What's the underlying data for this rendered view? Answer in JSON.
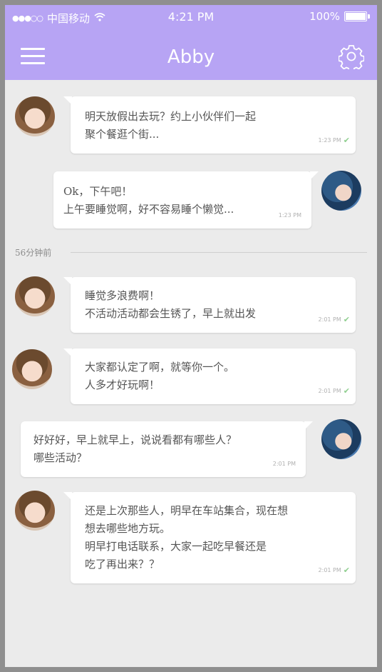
{
  "status_bar": {
    "signal_dots": "●●●○○",
    "carrier": "中国移动",
    "wifi_icon": "wifi-icon",
    "time": "4:21 PM",
    "battery": "100%"
  },
  "header": {
    "title": "Abby",
    "menu_icon": "menu-icon",
    "settings_icon": "gear-icon",
    "bar_color": "#b7a4f4"
  },
  "divider": {
    "label": "56分钟前"
  },
  "messages": [
    {
      "side": "left",
      "text": "明天放假出去玩？约上小伙伴们一起\n聚个餐逛个街...",
      "time": "1:23 PM",
      "read": true
    },
    {
      "side": "right",
      "text": "Ok，下午吧！\n上午要睡觉啊，好不容易睡个懒觉...",
      "time": "1:23 PM",
      "read": false
    },
    {
      "side": "left",
      "text": "睡觉多浪费啊！\n不活动活动都会生锈了，早上就出发",
      "time": "2:01 PM",
      "read": true
    },
    {
      "side": "left",
      "text": "大家都认定了啊，就等你一个。\n人多才好玩啊！",
      "time": "2:01 PM",
      "read": true
    },
    {
      "side": "right",
      "text": "好好好，早上就早上，说说看都有哪些人？\n哪些活动？",
      "time": "2:01 PM",
      "read": false
    },
    {
      "side": "left",
      "text": "还是上次那些人，明早在车站集合，现在想\n想去哪些地方玩。\n明早打电话联系，大家一起吃早餐还是\n吃了再出来？？",
      "time": "2:01 PM",
      "read": true
    }
  ]
}
